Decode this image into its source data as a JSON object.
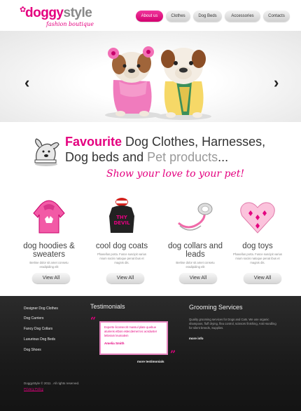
{
  "logo": {
    "word1": "doggy",
    "word2": "style",
    "tagline": "fashion boutique"
  },
  "nav": {
    "items": [
      {
        "label": "About us"
      },
      {
        "label": "Clothes"
      },
      {
        "label": "Dog Beds"
      },
      {
        "label": "Accessories"
      },
      {
        "label": "Contacts"
      }
    ],
    "active_color": "#e4007f"
  },
  "hero": {
    "prev_glyph": "‹",
    "next_glyph": "›"
  },
  "headline": {
    "part1": "Favourite",
    "part2": " Dog Clothes, Harnesses, Dog beds and ",
    "part3": "Pet products",
    "part4": "...",
    "slogan": "Show your love to your pet!"
  },
  "products": [
    {
      "title": "dog hoodies & sweaters",
      "desc": "Bertise dolor sit amet consetu eradipiding elit",
      "button": "View All"
    },
    {
      "title": "cool dog coats",
      "desc": "Phasellus porta. Fusce suscipit varius mium sociis natoque penat ibus et magnis dis.",
      "button": "View All"
    },
    {
      "title": "dog collars and leads",
      "desc": "Bertise dolor sit amet consetu eradipiding elit",
      "button": "View All"
    },
    {
      "title": "dog toys",
      "desc": "Phasellus porta. Fusce suscipit varius mium sociis natoque penat ibus et magnis dis.",
      "button": "View All"
    }
  ],
  "footer": {
    "links": [
      "Designer Dog Clothes",
      "Dog Carriers",
      "Fancy Dog Collars",
      "Luxurious Dog Beds",
      "Dog Shoes"
    ],
    "testimonials": {
      "title": "Testimonials",
      "quote_open": "“",
      "quote_close": "”",
      "text": "Experte liconsecrit massul plate quebue aturiens etbos estecdemet tec acsduster letteram leumalem",
      "author": "Amelia Smith",
      "more": "more testimonials"
    },
    "grooming": {
      "title": "Grooming Services",
      "text": "Quality grooming services for Dogs and Cats. We use organic shampoos, fluff drying, flea control, scissors finishing, Anti Handling for silent breeds, Supplies.",
      "more": "more info"
    },
    "copyright": "DoggyStyle © 2011 . All rights reserved.",
    "privacy": "Privacy Policy"
  }
}
